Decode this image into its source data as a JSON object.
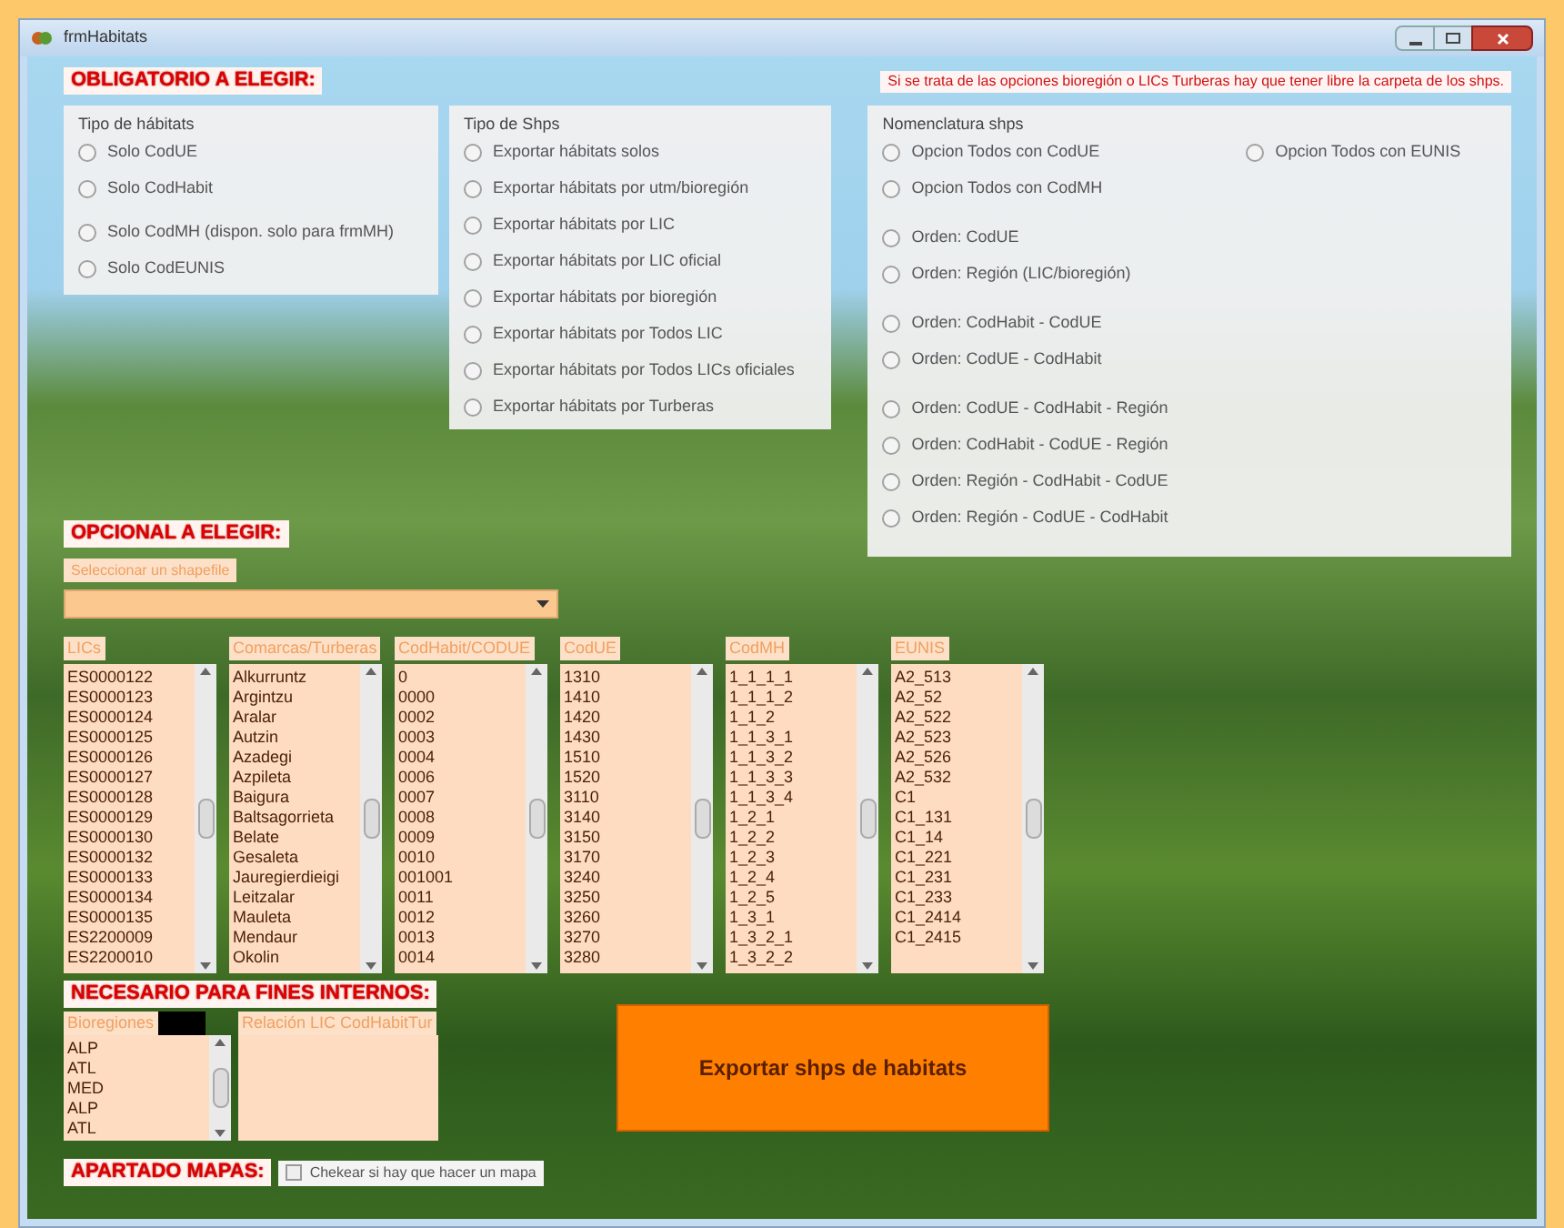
{
  "window": {
    "title": "frmHabitats"
  },
  "obligatorio": {
    "heading": "OBLIGATORIO A ELEGIR:",
    "note": "Si se trata de las opciones bioregión o LICs Turberas hay  que tener libre la carpeta de los shps.",
    "tipo_habitats": {
      "title": "Tipo de hábitats",
      "options": [
        {
          "label": "Solo CodUE",
          "selected": false
        },
        {
          "label": "Solo CodHabit",
          "selected": false
        },
        {
          "label": "Solo CodMH (dispon. solo para frmMH)",
          "selected": false
        },
        {
          "label": "Solo CodEUNIS",
          "selected": false
        }
      ]
    },
    "tipo_shps": {
      "title": "Tipo de Shps",
      "options": [
        {
          "label": "Exportar hábitats solos",
          "selected": false
        },
        {
          "label": "Exportar hábitats por utm/bioregión",
          "selected": false
        },
        {
          "label": "Exportar hábitats por LIC",
          "selected": false
        },
        {
          "label": "Exportar hábitats por LIC oficial",
          "selected": false
        },
        {
          "label": "Exportar hábitats por bioregión",
          "selected": false
        },
        {
          "label": "Exportar hábitats por Todos LIC",
          "selected": false
        },
        {
          "label": "Exportar hábitats por Todos LICs oficiales",
          "selected": false
        },
        {
          "label": "Exportar hábitats por Turberas",
          "selected": false
        }
      ]
    },
    "nomenclatura": {
      "title": "Nomenclatura shps",
      "options": [
        {
          "label": "Opcion Todos con CodUE",
          "selected": false
        },
        {
          "label": "Opcion Todos con CodMH",
          "selected": false
        },
        {
          "label": "Orden: CodUE",
          "selected": false
        },
        {
          "label": "Orden: Región (LIC/bioregión)",
          "selected": false
        },
        {
          "label": "Orden: CodHabit - CodUE",
          "selected": false
        },
        {
          "label": "Orden: CodUE - CodHabit",
          "selected": false
        },
        {
          "label": "Orden: CodUE - CodHabit - Región",
          "selected": false
        },
        {
          "label": "Orden: CodHabit - CodUE - Región",
          "selected": false
        },
        {
          "label": "Orden: Región - CodHabit - CodUE",
          "selected": false
        },
        {
          "label": "Orden: Región - CodUE - CodHabit",
          "selected": false
        }
      ],
      "side_option": {
        "label": "Opcion Todos con EUNIS",
        "selected": false
      }
    }
  },
  "opcional": {
    "heading": "OPCIONAL A ELEGIR:",
    "combo_label": "Seleccionar un shapefile"
  },
  "lists": [
    {
      "header": "LICs",
      "items": [
        "ES0000122",
        "ES0000123",
        "ES0000124",
        "ES0000125",
        "ES0000126",
        "ES0000127",
        "ES0000128",
        "ES0000129",
        "ES0000130",
        "ES0000132",
        "ES0000133",
        "ES0000134",
        "ES0000135",
        "ES2200009",
        "ES2200010"
      ]
    },
    {
      "header": "Comarcas/Turberas",
      "items": [
        "Alkurruntz",
        "Argintzu",
        "Aralar",
        "Autzin",
        "Azadegi",
        "Azpileta",
        "Baigura",
        "Baltsagorrieta",
        "Belate",
        "Gesaleta",
        "Jauregierdieigi",
        "Leitzalar",
        "Mauleta",
        "Mendaur",
        "Okolin"
      ]
    },
    {
      "header": "CodHabit/CODUE",
      "items": [
        "0",
        "0000",
        "0002",
        "0003",
        "0004",
        "0006",
        "0007",
        "0008",
        "0009",
        "0010",
        "001001",
        "0011",
        "0012",
        "0013",
        "0014"
      ]
    },
    {
      "header": "CodUE",
      "items": [
        "1310",
        "1410",
        "1420",
        "1430",
        "1510",
        "1520",
        "3110",
        "3140",
        "3150",
        "3170",
        "3240",
        "3250",
        "3260",
        "3270",
        "3280"
      ]
    },
    {
      "header": "CodMH",
      "items": [
        "1_1_1_1",
        "1_1_1_2",
        "1_1_2",
        "1_1_3_1",
        "1_1_3_2",
        "1_1_3_3",
        "1_1_3_4",
        "1_2_1",
        "1_2_2",
        "1_2_3",
        "1_2_4",
        "1_2_5",
        "1_3_1",
        "1_3_2_1",
        "1_3_2_2"
      ]
    },
    {
      "header": "EUNIS",
      "items": [
        "A2_513",
        "A2_52",
        "A2_522",
        "A2_523",
        "A2_526",
        "A2_532",
        "C1",
        "C1_131",
        "C1_14",
        "C1_221",
        "C1_231",
        "C1_233",
        "C1_2414",
        "C1_2415"
      ]
    }
  ],
  "necesario": {
    "heading": "NECESARIO PARA FINES INTERNOS:",
    "bioregiones": {
      "header": "Bioregiones",
      "items": [
        "ALP",
        "ATL",
        "MED",
        "ALP",
        "ATL"
      ]
    },
    "relacion": {
      "header": "Relación LIC CodHabitTur"
    }
  },
  "export_button": "Exportar shps de habitats",
  "mapas": {
    "heading": "APARTADO MAPAS:",
    "checkbox": {
      "label": "Chekear si hay que hacer un mapa",
      "checked": false
    }
  }
}
